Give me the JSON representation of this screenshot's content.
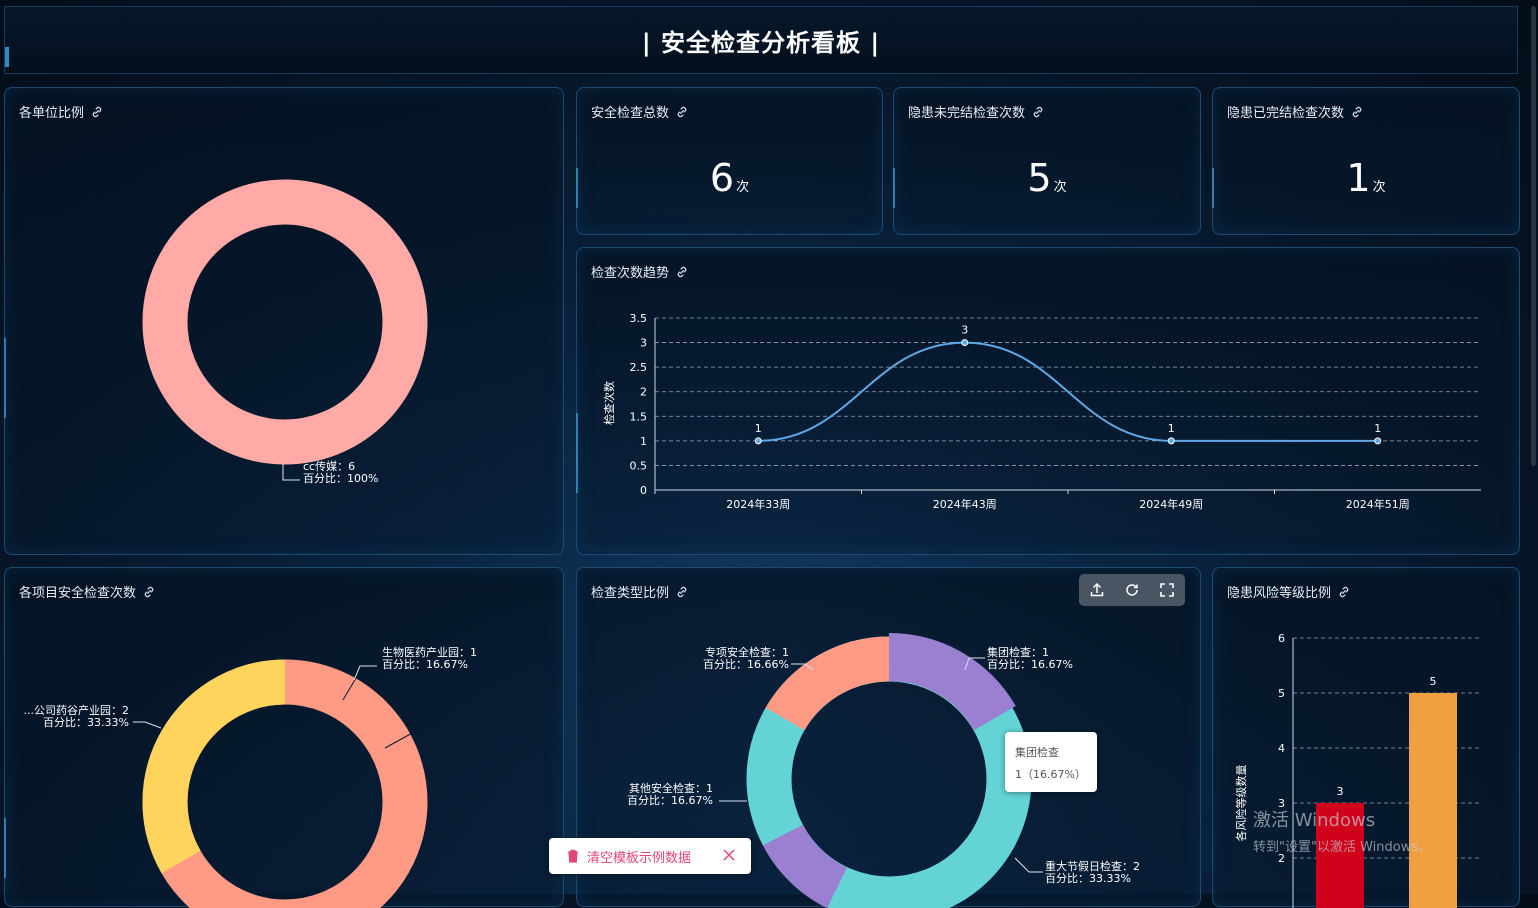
{
  "header": {
    "title": "|  安全检查分析看板  |"
  },
  "panels": {
    "unit_ratio": {
      "title": "各单位比例"
    },
    "kpi_total": {
      "title": "安全检查总数",
      "value": "6",
      "unit": "次"
    },
    "kpi_open": {
      "title": "隐患未完结检查次数",
      "value": "5",
      "unit": "次"
    },
    "kpi_closed": {
      "title": "隐患已完结检查次数",
      "value": "1",
      "unit": "次"
    },
    "trend": {
      "title": "检查次数趋势"
    },
    "project": {
      "title": "各项目安全检查次数"
    },
    "type_ratio": {
      "title": "检查类型比例"
    },
    "risk": {
      "title": "隐患风险等级比例"
    }
  },
  "tooltip": {
    "name": "集团检查",
    "value": "1（16.67%）"
  },
  "clear_button": {
    "label": "清空模板示例数据"
  },
  "watermark": {
    "line1": "激活 Windows",
    "line2": "转到\"设置\"以激活 Windows。"
  },
  "colors": {
    "accent": "#3aa0d8",
    "pink": "#ffaaa6",
    "salmon": "#ff9b85",
    "yellow": "#ffd45c",
    "purple": "#9b7fd0",
    "teal": "#63d3d6",
    "red": "#d0021b",
    "orange": "#f0a040"
  },
  "chart_data": [
    {
      "type": "pie",
      "labels": [
        "cc传媒"
      ],
      "values": [
        6
      ],
      "data_labels": [
        [
          "cc传媒：6",
          "百分比：100%"
        ]
      ]
    },
    {
      "type": "line",
      "categories": [
        "2024年33周",
        "2024年43周",
        "2024年49周",
        "2024年51周"
      ],
      "values": [
        1,
        3,
        1,
        1
      ],
      "ylabel": "检查次数",
      "ylim": [
        0,
        3.5
      ],
      "yticks": [
        "0",
        "0.5",
        "1",
        "1.5",
        "2",
        "2.5",
        "3",
        "3.5"
      ],
      "grid": true
    },
    {
      "type": "pie",
      "labels": [
        "生物医药产业园",
        "...公司药谷产业园"
      ],
      "values": [
        1,
        2
      ],
      "data_labels": [
        [
          "生物医药产业园：1",
          "百分比：16.67%"
        ],
        [
          "...公司药谷产业园：2",
          "百分比：33.33%"
        ]
      ]
    },
    {
      "type": "pie",
      "labels": [
        "集团检查",
        "重大节假日检查",
        "其他安全检查",
        "专项安全检查"
      ],
      "values": [
        1,
        2,
        1,
        1
      ],
      "data_labels": [
        [
          "集团检查：1",
          "百分比：16.67%"
        ],
        [
          "重大节假日检查：2",
          "百分比：33.33%"
        ],
        [
          "其他安全检查：1",
          "百分比：16.67%"
        ],
        [
          "专项安全检查：1",
          "百分比：16.66%"
        ]
      ]
    },
    {
      "type": "bar",
      "values": [
        3,
        5
      ],
      "ylabel": "各风险等级数量",
      "ylim": [
        0,
        6
      ],
      "yticks": [
        "2",
        "3",
        "4",
        "5",
        "6"
      ],
      "grid": true
    }
  ]
}
